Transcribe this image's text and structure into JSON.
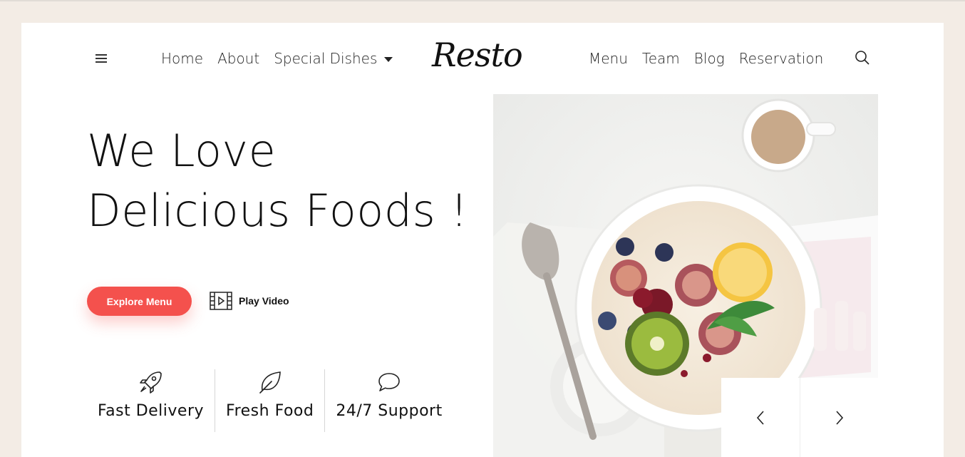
{
  "header": {
    "logo": "Resto",
    "nav_left": [
      {
        "label": "Home"
      },
      {
        "label": "About"
      },
      {
        "label": "Special Dishes",
        "dropdown": true
      }
    ],
    "nav_right": [
      {
        "label": "Menu"
      },
      {
        "label": "Team"
      },
      {
        "label": "Blog"
      },
      {
        "label": "Reservation"
      }
    ],
    "icons": {
      "menu": "hamburger-icon",
      "search": "search-icon"
    }
  },
  "hero": {
    "title_line1": "We Love",
    "title_line2": "Delicious Foods !",
    "explore_label": "Explore Menu",
    "play_label": "Play Video"
  },
  "features": [
    {
      "label": "Fast Delivery",
      "icon": "rocket-icon"
    },
    {
      "label": "Fresh Food",
      "icon": "leaf-icon"
    },
    {
      "label": "24/7 Support",
      "icon": "chat-bubble-icon"
    }
  ],
  "colors": {
    "accent": "#f4514d",
    "page_bg": "#f3ece5",
    "card_bg": "#ffffff",
    "text": "#111111"
  }
}
